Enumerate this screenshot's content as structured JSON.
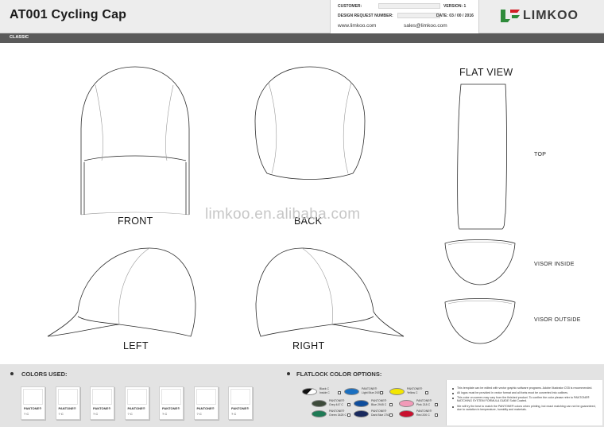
{
  "header": {
    "title": "AT001 Cycling Cap",
    "customer_label": "CUSTOMER:",
    "design_request_label": "DESIGN REQUEST NUMBER:",
    "version": "VERSION: 1",
    "date": "DATE: 03 / 00 / 2016",
    "website": "www.limkoo.com",
    "email": "sales@limkoo.com",
    "brand": "LIMKOO",
    "brand_color": "#2e8b3a"
  },
  "subbar": {
    "label": "CLASSIC"
  },
  "views": {
    "front": "FRONT",
    "back": "BACK",
    "left": "LEFT",
    "right": "RIGHT",
    "flat_view": "FLAT VIEW",
    "top": "TOP",
    "visor_inside": "VISOR INSIDE",
    "visor_outside": "VISOR OUTSIDE"
  },
  "watermark": "limkoo.en.alibaba.com",
  "colors_used": {
    "heading": "COLORS USED:",
    "chips": [
      {
        "label": "PANTONE®",
        "code": "? C"
      },
      {
        "label": "PANTONE®",
        "code": "? C"
      },
      {
        "label": "PANTONE®",
        "code": "? C"
      },
      {
        "label": "PANTONE®",
        "code": "? C"
      },
      {
        "label": "PANTONE®",
        "code": "? C"
      },
      {
        "label": "PANTONE®",
        "code": "? C"
      },
      {
        "label": "PANTONE®",
        "code": "? C"
      }
    ]
  },
  "flatlock": {
    "heading": "FLATLOCK COLOR OPTIONS:",
    "options": [
      {
        "line1": "Black C",
        "line2": "Inside C",
        "color": "#111111",
        "split": true
      },
      {
        "line1": "PANTONE®",
        "line2": "Light Blue 2925 C",
        "color": "#1a6fc0"
      },
      {
        "line1": "PANTONE®",
        "line2": "Yellow C",
        "color": "#f3e600"
      },
      {
        "line1": "PANTONE®",
        "line2": "Grey 447 C",
        "color": "#3d4a3a"
      },
      {
        "line1": "PANTONE®",
        "line2": "Blue 2945 C",
        "color": "#0f4d9c"
      },
      {
        "line1": "PANTONE®",
        "line2": "Pink 218 C",
        "color": "#f29ab8"
      },
      {
        "line1": "PANTONE®",
        "line2": "Green 3425 C",
        "color": "#1f7a55"
      },
      {
        "line1": "PANTONE®",
        "line2": "Dark Blue 2767 C",
        "color": "#1a2a5e"
      },
      {
        "line1": "PANTONE®",
        "line2": "Red 200 C",
        "color": "#c8102e"
      }
    ]
  },
  "notes": [
    "This template can be edited with vector graphic software programs. Adobe Illustrator CS5 is recommended.",
    "All logos must be provided in vector format and all fonts must be converted into outlines.",
    "This color on-screen may vary from the finished product. To confirm the color please refer to PANTONE® MATCHING SYSTEM FORMULA GUIDE Solid Coated.",
    "We will try the best to match the PANTONE® colors when printing, but exact matching can not be guaranteed, due to variation in temperature, humidity and materials."
  ]
}
